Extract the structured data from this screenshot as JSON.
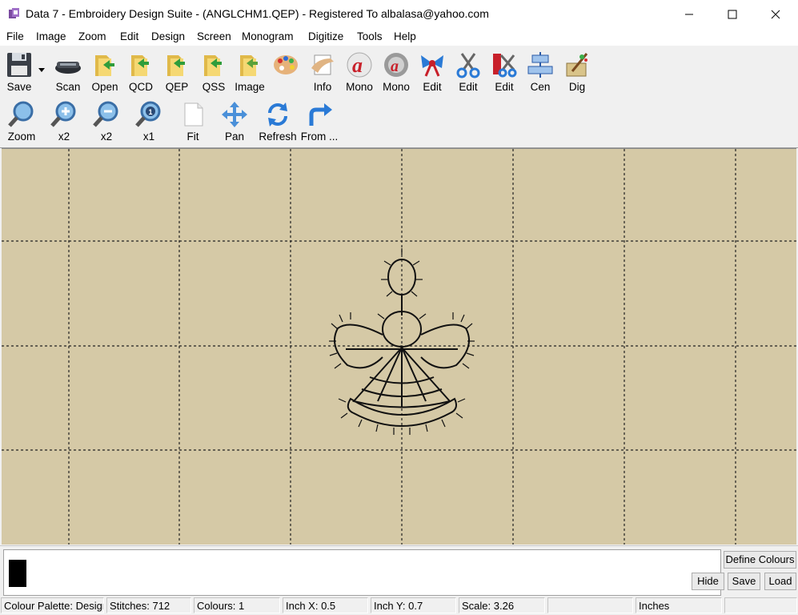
{
  "window": {
    "title": "Data 7 - Embroidery Design Suite - (ANGLCHM1.QEP) - Registered To albalasa@yahoo.com"
  },
  "menu": [
    "File",
    "Image",
    "Zoom",
    "Edit",
    "Design",
    "Screen",
    "Monogram",
    "Digitize",
    "Tools",
    "Help"
  ],
  "toolbar_row1": [
    {
      "label": "Save",
      "icon": "floppy-disk-icon"
    },
    {
      "label": "Scan",
      "icon": "scanner-icon"
    },
    {
      "label": "Open",
      "icon": "folder-open-icon"
    },
    {
      "label": "QCD",
      "icon": "folder-green-arrow-icon"
    },
    {
      "label": "QEP",
      "icon": "folder-green-arrow-icon"
    },
    {
      "label": "QSS",
      "icon": "folder-green-arrow-icon"
    },
    {
      "label": "Image",
      "icon": "folder-image-icon"
    },
    {
      "label": "",
      "icon": "palette-icon"
    },
    {
      "label": "Info",
      "icon": "info-hand-icon"
    },
    {
      "label": "Mono",
      "icon": "monogram-a-icon"
    },
    {
      "label": "Mono",
      "icon": "monogram-gear-icon"
    },
    {
      "label": "Edit",
      "icon": "bow-edit-icon"
    },
    {
      "label": "Edit",
      "icon": "scissors-icon"
    },
    {
      "label": "Edit",
      "icon": "scissors-red-icon"
    },
    {
      "label": "Cen",
      "icon": "center-icon"
    },
    {
      "label": "Dig",
      "icon": "digitize-brush-icon"
    }
  ],
  "toolbar_row2": [
    {
      "label": "Zoom",
      "icon": "magnifier-icon"
    },
    {
      "label": "x2",
      "icon": "zoom-in-icon"
    },
    {
      "label": "x2",
      "icon": "zoom-out-icon"
    },
    {
      "label": "x1",
      "icon": "zoom-actual-icon"
    },
    {
      "label": "Fit",
      "icon": "page-fit-icon"
    },
    {
      "label": "Pan",
      "icon": "pan-arrows-icon"
    },
    {
      "label": "Refresh",
      "icon": "refresh-icon"
    },
    {
      "label": "From ...",
      "icon": "redirect-arrow-icon"
    }
  ],
  "palette_buttons": {
    "define": "Define Colours",
    "hide": "Hide",
    "save": "Save",
    "load": "Load"
  },
  "status": {
    "palette": "Colour Palette: Design",
    "stitches": "Stitches: 712",
    "colours": "Colours: 1",
    "inch_x": "Inch X: 0.5",
    "inch_y": "Inch Y: 0.7",
    "scale": "Scale: 3.26",
    "empty": "",
    "units": "Inches"
  },
  "colors": {
    "canvas": "#d5c9a6",
    "swatch": "#000000"
  }
}
